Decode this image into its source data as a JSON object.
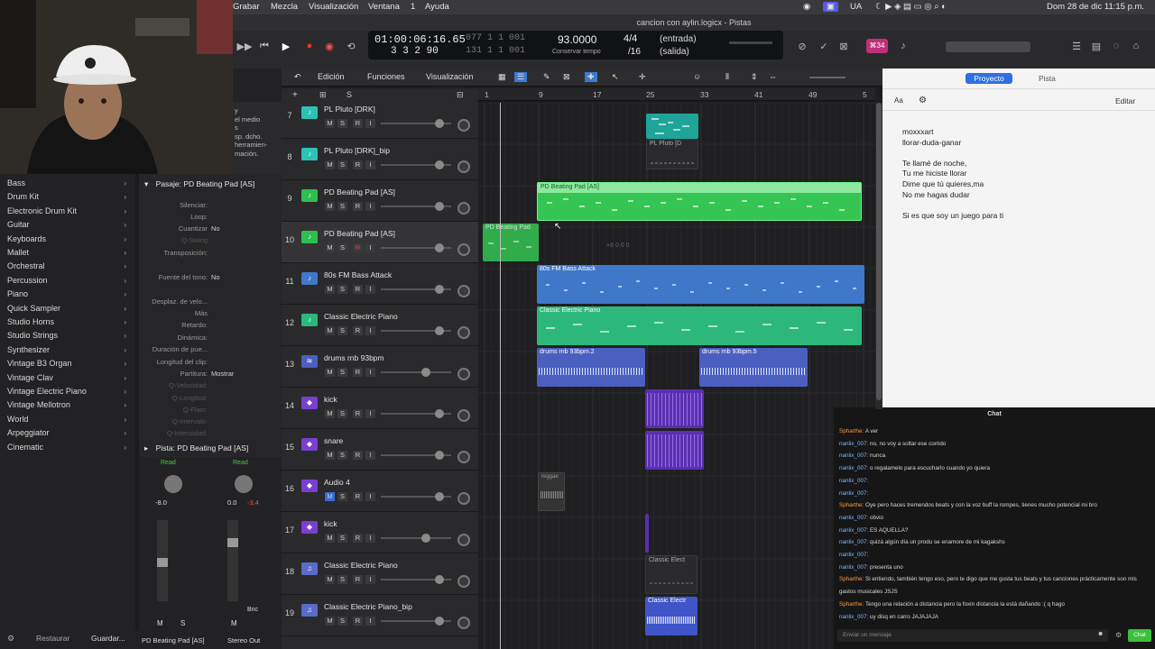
{
  "menubar": {
    "items": [
      "Grabar",
      "Mezcla",
      "Visualización",
      "Ventana",
      "1",
      "Ayuda"
    ],
    "status": [
      "UA",
      "Dom 28 de dic 11:15 p.m."
    ]
  },
  "title": "cancion con aylin.logicx - Pistas",
  "lcd": {
    "time": "01:00:06:16.65",
    "bars": "3  3  2  90",
    "pos1": "077  1  1  001",
    "pos2": "131  1  1  001",
    "tempo": "93.0000",
    "tempo_label": "Conservar tempo",
    "sig": "4/4",
    "div": "/16",
    "in": "(entrada)",
    "out": "(salida)",
    "badge": "⌘34"
  },
  "toolbar": {
    "edicion": "Edición",
    "funciones": "Funciones",
    "visualizacion": "Visualización",
    "s_label": "S"
  },
  "ruler": [
    "1",
    "9",
    "17",
    "25",
    "33",
    "41",
    "49",
    "5"
  ],
  "library": [
    {
      "label": "Bass"
    },
    {
      "label": "Drum Kit"
    },
    {
      "label": "Electronic Drum Kit"
    },
    {
      "label": "Guitar"
    },
    {
      "label": "Keyboards"
    },
    {
      "label": "Mallet"
    },
    {
      "label": "Orchestral"
    },
    {
      "label": "Percussion"
    },
    {
      "label": "Piano"
    },
    {
      "label": "Quick Sampler"
    },
    {
      "label": "Studio Horns"
    },
    {
      "label": "Studio Strings"
    },
    {
      "label": "Synthesizer"
    },
    {
      "label": "Vintage B3 Organ"
    },
    {
      "label": "Vintage Clav"
    },
    {
      "label": "Vintage Electric Piano"
    },
    {
      "label": "Vintage Mellotron"
    },
    {
      "label": "World"
    },
    {
      "label": "Arpeggiator"
    },
    {
      "label": "Cinematic"
    }
  ],
  "lib_top_text": [
    "y",
    "el medio",
    "s",
    "sp. dcho.",
    "herramien-",
    "mación."
  ],
  "inspector": {
    "header": "Pasaje: PD Beating Pad [AS]",
    "rows": [
      {
        "label": "Silenciar:",
        "value": ""
      },
      {
        "label": "Loop:",
        "value": ""
      },
      {
        "label": "Cuantizar",
        "value": "No"
      },
      {
        "label": "Q-Swing",
        "value": ""
      },
      {
        "label": "Transposición:",
        "value": ""
      },
      {
        "label": "Fuente del tono:",
        "value": "No"
      },
      {
        "label": "Desplaz. de velo...",
        "value": ""
      },
      {
        "label": "Más",
        "value": ""
      },
      {
        "label": "Retardo:",
        "value": ""
      },
      {
        "label": "Dinámica:",
        "value": ""
      },
      {
        "label": "Duración de pue...",
        "value": ""
      },
      {
        "label": "Longitud del clip:",
        "value": ""
      },
      {
        "label": "Partitura:",
        "value": "Mostrar"
      },
      {
        "label": "Q-Velocidad:",
        "value": ""
      },
      {
        "label": "Q-Longitud:",
        "value": ""
      },
      {
        "label": "Q-Flam:",
        "value": ""
      },
      {
        "label": "Q-Intervalo:",
        "value": ""
      },
      {
        "label": "Q-Intensidad:",
        "value": ""
      }
    ],
    "pista": "Pista:  PD Beating Pad [AS]"
  },
  "mixer": {
    "read1": "Read",
    "read2": "Read",
    "val1": "-8.0",
    "val2a": "0.0",
    "val2b": "-3.4",
    "m1": "M",
    "s1": "S",
    "m2": "M",
    "bnc": "Bnc",
    "name1": "PD Beating Pad [AS]",
    "name2": "Stereo Out",
    "restaurar": "Restaurar",
    "guardar": "Guardar..."
  },
  "tracks": [
    {
      "num": "7",
      "name": "PL Pluto [DRK]",
      "type": "midi",
      "color": "#2cc3b5"
    },
    {
      "num": "8",
      "name": "PL Pluto [DRK]_bip",
      "type": "midi",
      "color": "#2cc3b5"
    },
    {
      "num": "9",
      "name": "PD Beating Pad [AS]",
      "type": "midi",
      "color": "#2fbf4f"
    },
    {
      "num": "10",
      "name": "PD Beating Pad [AS]",
      "type": "midi",
      "color": "#2fbf4f"
    },
    {
      "num": "11",
      "name": "80s FM Bass Attack",
      "type": "midi",
      "color": "#3f78c9"
    },
    {
      "num": "12",
      "name": "Classic Electric Piano",
      "type": "midi",
      "color": "#2cb87a"
    },
    {
      "num": "13",
      "name": "drums rnb 93bpm",
      "type": "audio",
      "color": "#4a5fc0"
    },
    {
      "num": "14",
      "name": "kick",
      "type": "drum",
      "color": "#7a3fd0"
    },
    {
      "num": "15",
      "name": "snare",
      "type": "drum",
      "color": "#7a3fd0"
    },
    {
      "num": "16",
      "name": "Audio 4",
      "type": "drum",
      "color": "#7a3fd0"
    },
    {
      "num": "17",
      "name": "kick",
      "type": "drum",
      "color": "#7a3fd0"
    },
    {
      "num": "18",
      "name": "Classic Electric Piano",
      "type": "piano",
      "color": "#5a6bc8"
    },
    {
      "num": "19",
      "name": "Classic Electric Piano_bip",
      "type": "piano",
      "color": "#5a6bc8"
    }
  ],
  "regions": {
    "pluto": "PL Pluto [D",
    "pad9": "PD Beating Pad [AS]",
    "pad10": "PD Beating Pad",
    "pad10val": "+8 0 0 0",
    "bass": "80s FM Bass Attack",
    "piano12": "Classic Electric Piano",
    "drums1": "drums rnb 93bpm.2",
    "drums2": "drums rnb 93bpm.5",
    "reggae": "reggae",
    "piano18": "Classic Elect",
    "piano19": "Classic Electr"
  },
  "right": {
    "tab1": "Proyecto",
    "tab2": "Pista",
    "aa": "Aa",
    "editar": "Editar",
    "lyrics": [
      "moxxxart",
      "llorar-duda-ganar",
      "",
      "Te llamé de noche,",
      "Tu me hiciste llorar",
      "Dime que tú quieres,ma",
      "No me hagas dudar",
      "",
      "Si es que soy un juego para ti"
    ]
  },
  "chat": {
    "title": "Chat",
    "placeholder": "Enviar un mensaje",
    "send": "Chat",
    "lines": [
      {
        "user": "Spharthe:",
        "text": " A ver",
        "c": 1
      },
      {
        "user": "nanlix_007:",
        "text": " no, no voy a soltar ese corrido",
        "c": 2
      },
      {
        "user": "nanlix_007:",
        "text": " nunca",
        "c": 2
      },
      {
        "user": "nanlix_007:",
        "text": " o regalamelo para escucharlo cuando yo quiera",
        "c": 2
      },
      {
        "user": "nanlix_007:",
        "text": " ",
        "c": 2
      },
      {
        "user": "nanlix_007:",
        "text": " ",
        "c": 2
      },
      {
        "user": "Spharthe:",
        "text": " Oye pero haces tremendos beats y con la voz buff la rompes, tienes mucho potencial mi bro",
        "c": 1
      },
      {
        "user": "nanlix_007:",
        "text": " obvio",
        "c": 2
      },
      {
        "user": "nanlix_007:",
        "text": " ES AQUELLA?",
        "c": 2
      },
      {
        "user": "nanlix_007:",
        "text": " quizá algún día un produ se enamore de mi kagakshs",
        "c": 2
      },
      {
        "user": "nanlix_007:",
        "text": " ",
        "c": 2
      },
      {
        "user": "nanlix_007:",
        "text": " presenta uno",
        "c": 2
      },
      {
        "user": "Spharthe:",
        "text": " Si entiendo, también tengo eso, pero te digo que me gusta tus beats y tus canciones prácticamente son mis",
        "c": 1
      },
      {
        "user": "",
        "text": "gastos musicales JSJS",
        "c": 0
      },
      {
        "user": "Spharthe:",
        "text": " Tengo una relación a distancia pero la foxin distancia la está dañando :( q hago",
        "c": 1
      },
      {
        "user": "nanlix_007:",
        "text": " uy disq en carro JAJAJAJA",
        "c": 2
      }
    ]
  }
}
